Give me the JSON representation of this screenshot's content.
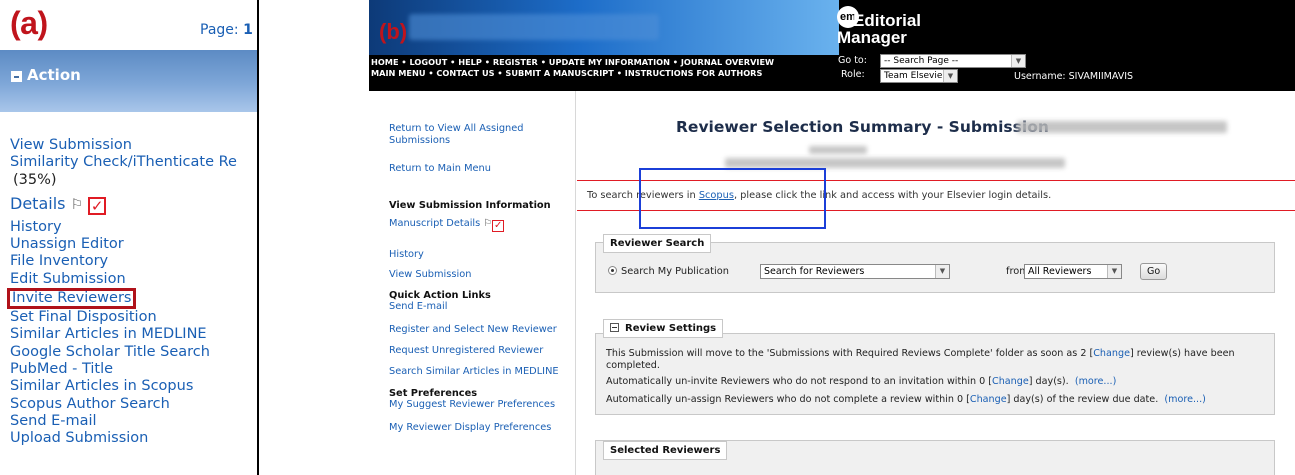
{
  "panel_a": {
    "label": "(a)",
    "page_prefix": "Page: ",
    "page_number": "1",
    "header_title": "Action",
    "menu": {
      "view_submission": "View Submission",
      "similarity_check": "Similarity Check/iThenticate Re",
      "similarity_pct": "(35%)",
      "details": "Details",
      "history": "History",
      "unassign_editor": "Unassign Editor",
      "file_inventory": "File Inventory",
      "edit_submission": "Edit Submission",
      "invite_reviewers": "Invite Reviewers",
      "set_final_disposition": "Set Final Disposition",
      "similar_medline": "Similar Articles in MEDLINE",
      "google_scholar": "Google Scholar Title Search",
      "pubmed": "PubMed - Title",
      "similar_scopus": "Similar Articles in Scopus",
      "scopus_author": "Scopus Author Search",
      "send_email": "Send E-mail",
      "partial_last": "Upload Submission"
    },
    "icons": {
      "flag": "flag-icon",
      "check": "checkbox-checked-icon",
      "collapse": "collapse-icon"
    },
    "colors": {
      "link": "#1a5fb4",
      "label": "#c0141c",
      "highlight_border": "#b0121a",
      "header": "#6f9ad0"
    }
  },
  "panel_b": {
    "label": "(b)",
    "logo": {
      "badge": "em",
      "line1": "Editorial",
      "line2": "Manager"
    },
    "nav_line1": "HOME • LOGOUT • HELP • REGISTER • UPDATE MY INFORMATION • JOURNAL OVERVIEW",
    "nav_line2": "MAIN MENU • CONTACT US • SUBMIT A MANUSCRIPT • INSTRUCTIONS FOR AUTHORS",
    "goto_label": "Go to:",
    "goto_value": "-- Search Page --",
    "role_label": "Role:",
    "role_value": "Team Elsevier",
    "username": "Username: SIVAMIIMAVIS",
    "sidebar": {
      "return_assigned_1": "Return to View All Assigned",
      "return_assigned_2": "Submissions",
      "return_main": "Return to Main Menu",
      "view_sub_info": "View Submission Information",
      "manuscript_details": "Manuscript Details",
      "history": "History",
      "view_submission": "View Submission",
      "quick_action": "Quick Action Links",
      "send_email": "Send E-mail",
      "register_select": "Register and Select New Reviewer",
      "request_unregistered": "Request Unregistered Reviewer",
      "search_similar": "Search Similar Articles in MEDLINE",
      "set_prefs": "Set Preferences",
      "suggest_prefs": "My Suggest Reviewer Preferences",
      "display_prefs": "My Reviewer Display Preferences"
    },
    "main": {
      "title": "Reviewer Selection Summary - Submission",
      "scopus_pre": "To search reviewers in ",
      "scopus_link": "Scopus",
      "scopus_post": ", please click the link and access with your Elsevier login details.",
      "reviewer_search_legend": "Reviewer Search",
      "search_my_pub": "Search My Publication",
      "search_select": "Search for Reviewers",
      "from_label": "from",
      "from_select": "All Reviewers",
      "go_button": "Go",
      "review_settings_legend": "Review Settings",
      "rs1_pre": "This Submission will move to the 'Submissions with Required Reviews Complete' folder as soon as 2 [",
      "rs1_link": "Change",
      "rs1_post": "] review(s) have been",
      "rs1_cont": "completed.",
      "rs2_pre": "Automatically un-invite Reviewers who do not respond to an invitation within 0 [",
      "rs2_link": "Change",
      "rs2_post": "] day(s).",
      "rs2_more": "(more...)",
      "rs3_pre": "Automatically un-assign Reviewers who do not complete a review within 0 [",
      "rs3_link": "Change",
      "rs3_post": "] day(s) of the review due date.",
      "rs3_more": "(more...)",
      "selected_legend": "Selected Reviewers"
    },
    "colors": {
      "topbar": "#000000",
      "link": "#1a5fb4",
      "alert_border": "#e01b24",
      "annotation_box": "#1b3fd8"
    }
  }
}
